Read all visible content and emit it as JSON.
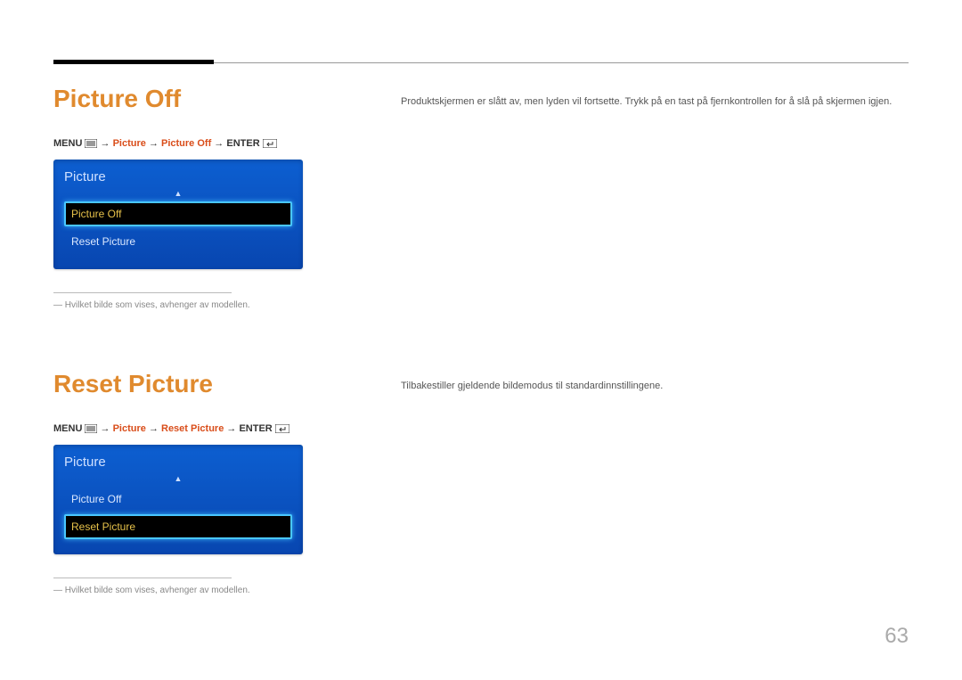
{
  "page_number": "63",
  "section1": {
    "heading": "Picture Off",
    "breadcrumb": {
      "menu": "MENU",
      "arrow": "→",
      "p1": "Picture",
      "p2": "Picture Off",
      "enter": "ENTER"
    },
    "panel": {
      "title": "Picture",
      "items": [
        "Picture Off",
        "Reset Picture"
      ],
      "selected_index": 0
    },
    "footnote": "―  Hvilket bilde som vises, avhenger av modellen.",
    "right_desc": "Produktskjermen er slått av, men lyden vil fortsette. Trykk på en tast på fjernkontrollen for å slå på skjermen igjen."
  },
  "section2": {
    "heading": "Reset Picture",
    "breadcrumb": {
      "menu": "MENU",
      "arrow": "→",
      "p1": "Picture",
      "p2": "Reset Picture",
      "enter": "ENTER"
    },
    "panel": {
      "title": "Picture",
      "items": [
        "Picture Off",
        "Reset Picture"
      ],
      "selected_index": 1
    },
    "footnote": "―  Hvilket bilde som vises, avhenger av modellen.",
    "right_desc": "Tilbakestiller gjeldende bildemodus til standardinnstillingene."
  }
}
